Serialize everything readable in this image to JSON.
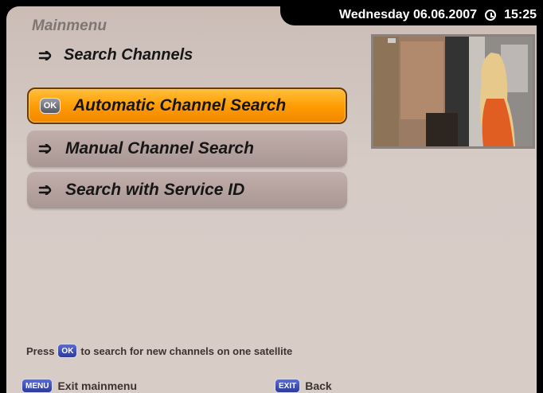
{
  "header": {
    "date_text": "Wednesday 06.06.2007",
    "time_text": "15:25",
    "menu_title": "Mainmenu"
  },
  "section": {
    "title": "Search Channels",
    "icon": "arrow-icon"
  },
  "menu": {
    "items": [
      {
        "label": "Automatic Channel Search",
        "selected": true,
        "icon": "ok-badge"
      },
      {
        "label": "Manual Channel Search",
        "selected": false,
        "icon": "arrow-icon"
      },
      {
        "label": "Search with Service ID",
        "selected": false,
        "icon": "arrow-icon"
      }
    ]
  },
  "hint": {
    "prefix": "Press",
    "button": "OK",
    "suffix": "to search for new channels on one satellite"
  },
  "footer": {
    "menu_button": "MENU",
    "menu_label": "Exit mainmenu",
    "exit_button": "EXIT",
    "exit_label": "Back"
  },
  "colors": {
    "background": "#d8ccc7",
    "selected_item": "#ff9a00",
    "item": "#b29f9b",
    "datebar": "#000000"
  }
}
